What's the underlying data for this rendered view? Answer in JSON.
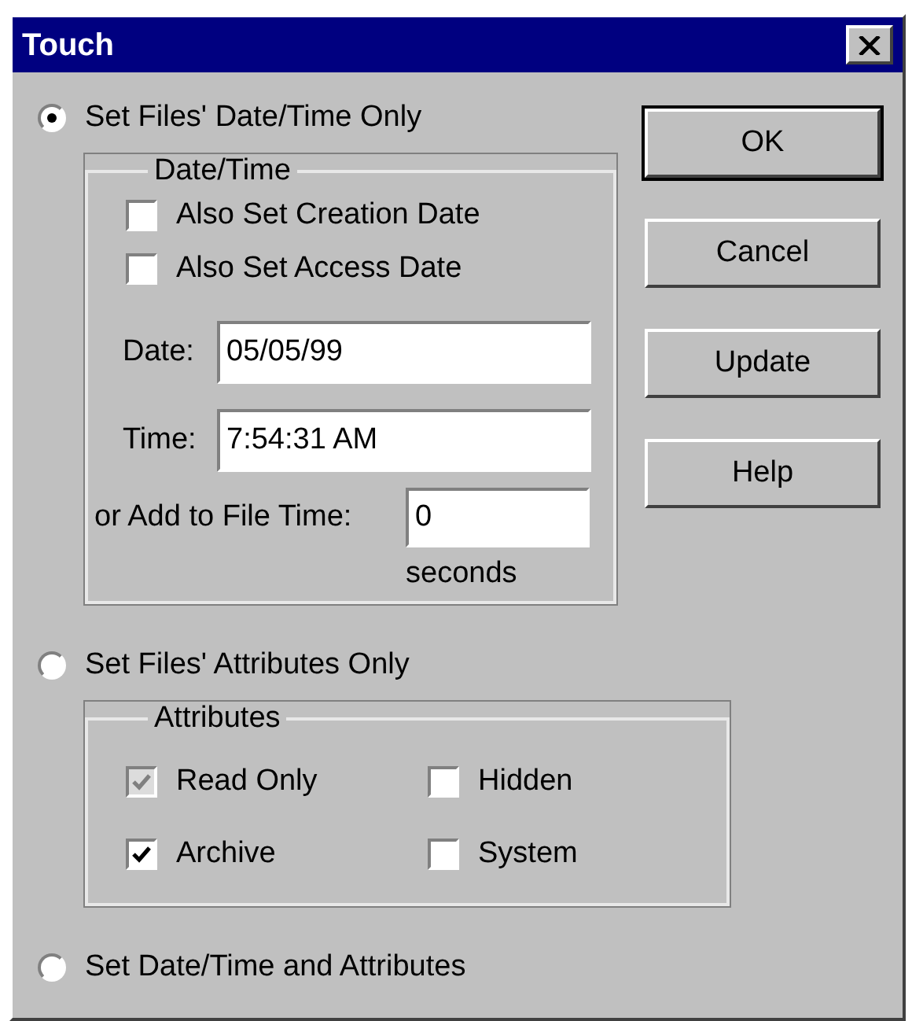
{
  "window": {
    "title": "Touch"
  },
  "options": [
    {
      "label": "Set Files' Date/Time Only",
      "selected": true,
      "group": {
        "kind": "datetime",
        "title": "Date/Time",
        "checkboxes": [
          {
            "label": "Also Set Creation Date",
            "checked": false,
            "disabled": false
          },
          {
            "label": "Also Set Access Date",
            "checked": false,
            "disabled": false
          }
        ],
        "fields": [
          {
            "kind": "text",
            "label": "Date:",
            "value": "05/05/99"
          },
          {
            "kind": "text",
            "label": "Time:",
            "value": "7:54:31 AM"
          },
          {
            "kind": "offset",
            "label": "or Add to File Time:",
            "value": "0",
            "unit": "seconds"
          }
        ]
      }
    },
    {
      "label": "Set Files' Attributes Only",
      "selected": false,
      "group": {
        "kind": "attributes",
        "title": "Attributes",
        "checkboxes": [
          {
            "label": "Read Only",
            "checked": true,
            "disabled": true
          },
          {
            "label": "Hidden",
            "checked": false,
            "disabled": false
          },
          {
            "label": "Archive",
            "checked": true,
            "disabled": false
          },
          {
            "label": "System",
            "checked": false,
            "disabled": false
          }
        ]
      }
    },
    {
      "label": "Set Date/Time and Attributes",
      "selected": false
    }
  ],
  "buttons": [
    {
      "label": "OK",
      "default": true
    },
    {
      "label": "Cancel",
      "default": false
    },
    {
      "label": "Update",
      "default": false
    },
    {
      "label": "Help",
      "default": false
    }
  ]
}
